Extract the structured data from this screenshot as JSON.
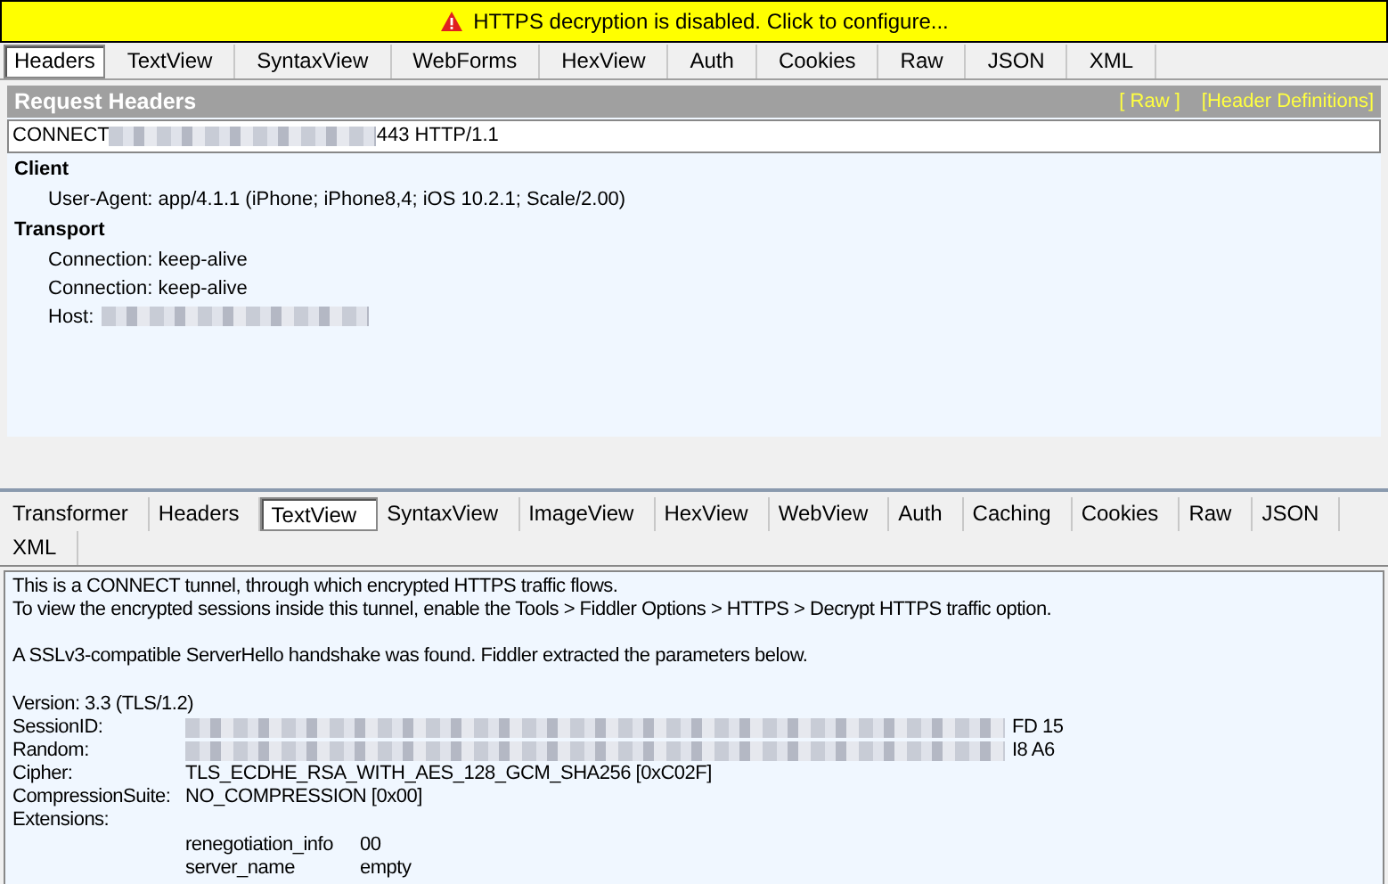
{
  "notification": {
    "text": "HTTPS decryption is disabled. Click to configure..."
  },
  "request_tabs": [
    {
      "label": "Headers",
      "selected": true
    },
    {
      "label": "TextView",
      "selected": false
    },
    {
      "label": "SyntaxView",
      "selected": false
    },
    {
      "label": "WebForms",
      "selected": false
    },
    {
      "label": "HexView",
      "selected": false
    },
    {
      "label": "Auth",
      "selected": false
    },
    {
      "label": "Cookies",
      "selected": false
    },
    {
      "label": "Raw",
      "selected": false
    },
    {
      "label": "JSON",
      "selected": false
    },
    {
      "label": "XML",
      "selected": false
    }
  ],
  "request_headers": {
    "title": "Request Headers",
    "links": [
      "[ Raw ]",
      "[Header Definitions]"
    ],
    "request_line": {
      "method": "CONNECT",
      "rest": "443 HTTP/1.1"
    },
    "groups": [
      {
        "name": "Client",
        "headers": [
          {
            "text": "User-Agent: app/4.1.1 (iPhone; iPhone8,4; iOS 10.2.1; Scale/2.00)",
            "redacted": false
          }
        ]
      },
      {
        "name": "Transport",
        "headers": [
          {
            "text": "Connection: keep-alive",
            "redacted": false
          },
          {
            "text": "Connection: keep-alive",
            "redacted": false
          },
          {
            "text": "Host:",
            "redacted": true
          }
        ]
      }
    ]
  },
  "response_tabs": [
    {
      "label": "Transformer",
      "selected": false
    },
    {
      "label": "Headers",
      "selected": false
    },
    {
      "label": "TextView",
      "selected": true
    },
    {
      "label": "SyntaxView",
      "selected": false
    },
    {
      "label": "ImageView",
      "selected": false
    },
    {
      "label": "HexView",
      "selected": false
    },
    {
      "label": "WebView",
      "selected": false
    },
    {
      "label": "Auth",
      "selected": false
    },
    {
      "label": "Caching",
      "selected": false
    },
    {
      "label": "Cookies",
      "selected": false
    },
    {
      "label": "Raw",
      "selected": false
    },
    {
      "label": "JSON",
      "selected": false
    },
    {
      "label": "XML",
      "selected": false
    }
  ],
  "text_view": {
    "paragraphs": [
      [
        "This is a CONNECT tunnel, through which encrypted HTTPS traffic flows.",
        "To view the encrypted sessions inside this tunnel, enable the Tools > Fiddler Options > HTTPS > Decrypt HTTPS traffic option."
      ],
      [
        "A SSLv3-compatible ServerHello handshake was found. Fiddler extracted the parameters below."
      ]
    ],
    "version": "Version: 3.3 (TLS/1.2)",
    "fields": [
      {
        "name": "SessionID:",
        "value": "FD 15",
        "redacted": true
      },
      {
        "name": "Random:",
        "value": "I8 A6",
        "redacted": true
      },
      {
        "name": "Cipher:",
        "value": "TLS_ECDHE_RSA_WITH_AES_128_GCM_SHA256 [0xC02F]",
        "redacted": false
      },
      {
        "name": "CompressionSuite:",
        "value": "NO_COMPRESSION [0x00]",
        "redacted": false
      },
      {
        "name": "Extensions:",
        "redacted": false
      }
    ],
    "extensions": [
      {
        "name": "renegotiation_info",
        "value": "00"
      },
      {
        "name": "server_name",
        "value": "empty"
      }
    ]
  }
}
